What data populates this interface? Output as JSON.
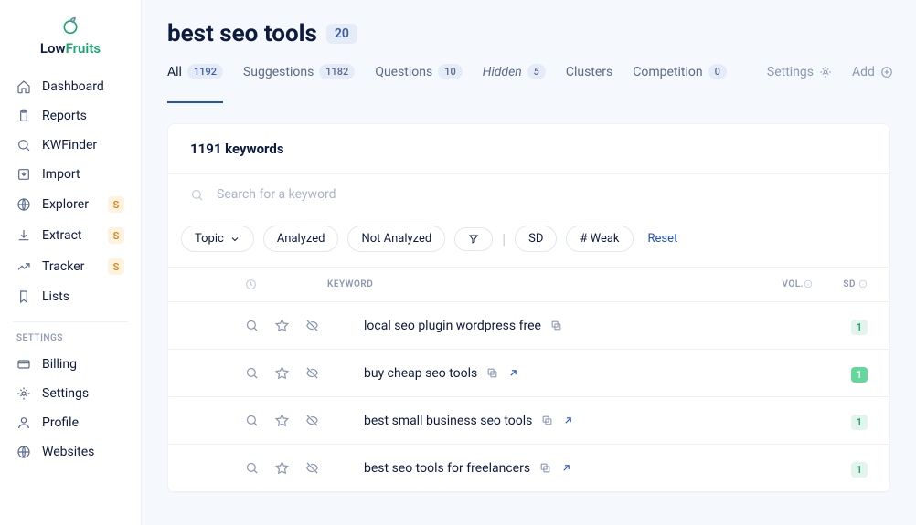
{
  "logo": {
    "low": "Low",
    "fruits": "Fruits"
  },
  "sidebar": {
    "items": [
      {
        "label": "Dashboard",
        "icon": "home"
      },
      {
        "label": "Reports",
        "icon": "clipboard"
      },
      {
        "label": "KWFinder",
        "icon": "search"
      },
      {
        "label": "Import",
        "icon": "import"
      },
      {
        "label": "Explorer",
        "icon": "globe",
        "badge": "S"
      },
      {
        "label": "Extract",
        "icon": "download",
        "badge": "S"
      },
      {
        "label": "Tracker",
        "icon": "trend",
        "badge": "S"
      },
      {
        "label": "Lists",
        "icon": "bookmark"
      }
    ],
    "settingsLabel": "SETTINGS",
    "settingsItems": [
      {
        "label": "Billing",
        "icon": "card"
      },
      {
        "label": "Settings",
        "icon": "gear"
      },
      {
        "label": "Profile",
        "icon": "user"
      },
      {
        "label": "Websites",
        "icon": "globe"
      }
    ]
  },
  "header": {
    "title": "best seo tools",
    "count": "20"
  },
  "tabs": [
    {
      "label": "All",
      "count": "1192",
      "active": true
    },
    {
      "label": "Suggestions",
      "count": "1182"
    },
    {
      "label": "Questions",
      "count": "10"
    },
    {
      "label": "Hidden",
      "count": "5",
      "italic": true
    },
    {
      "label": "Clusters"
    },
    {
      "label": "Competition",
      "count": "0"
    }
  ],
  "rightTabs": {
    "settings": "Settings",
    "add": "Add"
  },
  "panel": {
    "keywordsCount": "1191 keywords",
    "searchPlaceholder": "Search for a keyword",
    "chips": {
      "topic": "Topic",
      "analyzed": "Analyzed",
      "notAnalyzed": "Not Analyzed",
      "sd": "SD",
      "weak": "# Weak"
    },
    "reset": "Reset",
    "columns": {
      "keyword": "KEYWORD",
      "vol": "VOL.",
      "sd": "SD"
    }
  },
  "rows": [
    {
      "keyword": "local seo plugin wordpress free",
      "sd": "1",
      "ext": false,
      "bright": false
    },
    {
      "keyword": "buy cheap seo tools",
      "sd": "1",
      "ext": true,
      "bright": true
    },
    {
      "keyword": "best small business seo tools",
      "sd": "1",
      "ext": true,
      "bright": false
    },
    {
      "keyword": "best seo tools for freelancers",
      "sd": "1",
      "ext": true,
      "bright": false
    }
  ]
}
